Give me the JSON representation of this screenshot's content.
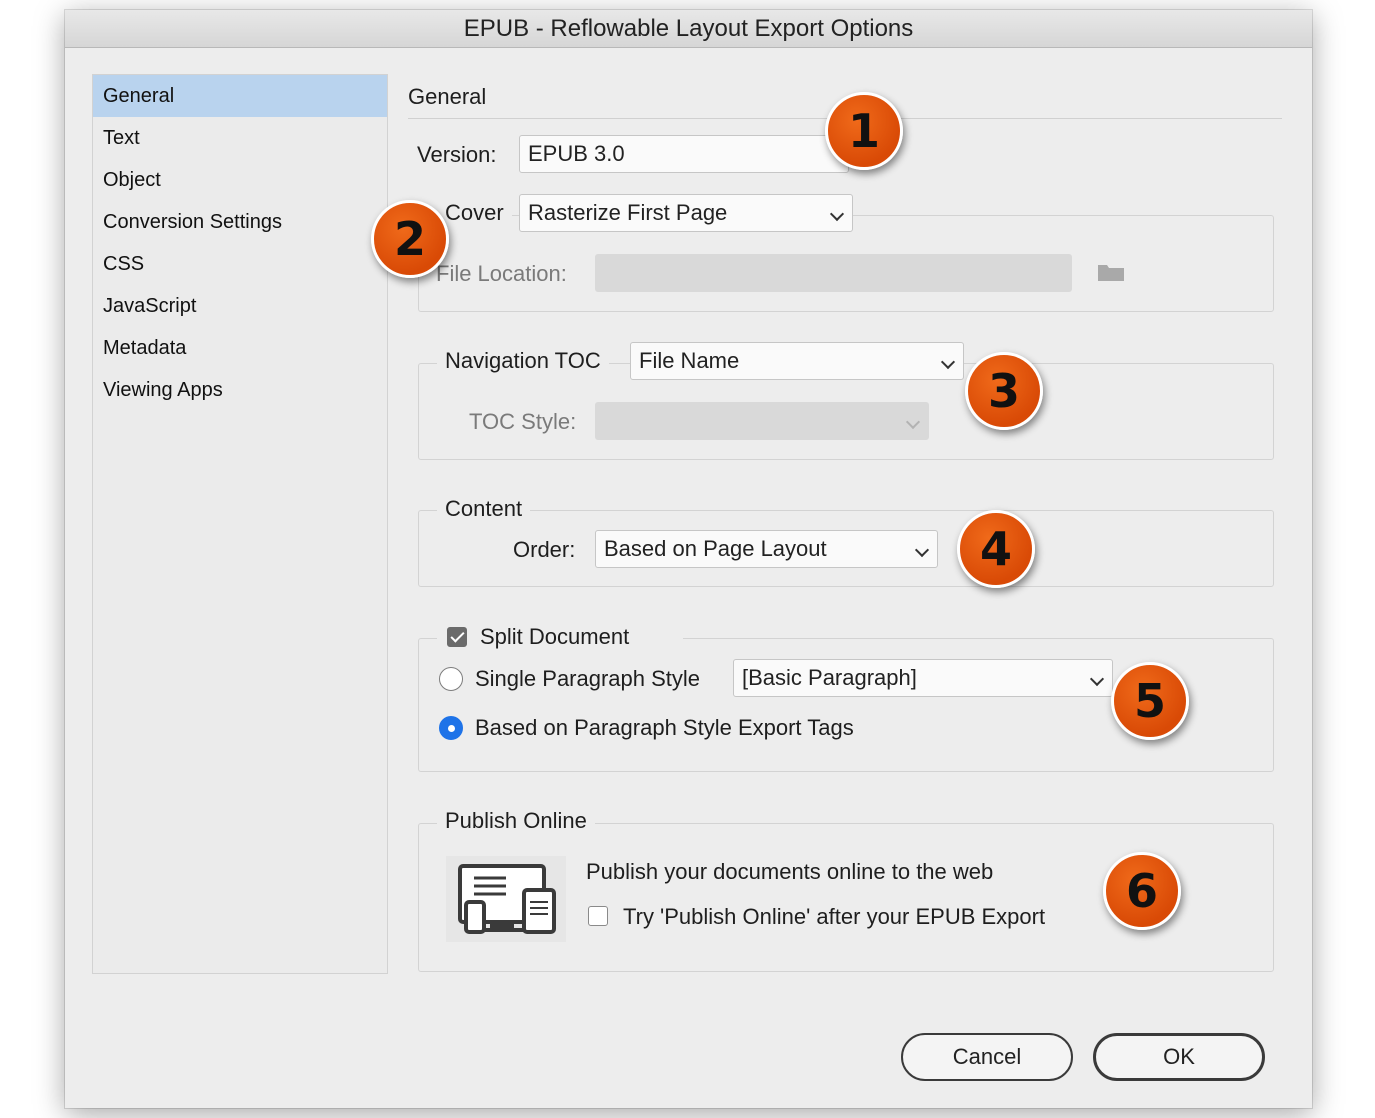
{
  "window": {
    "title": "EPUB - Reflowable Layout Export Options"
  },
  "sidebar": {
    "items": [
      {
        "label": "General",
        "selected": true
      },
      {
        "label": "Text"
      },
      {
        "label": "Object"
      },
      {
        "label": "Conversion Settings"
      },
      {
        "label": "CSS"
      },
      {
        "label": "JavaScript"
      },
      {
        "label": "Metadata"
      },
      {
        "label": "Viewing Apps"
      }
    ]
  },
  "general": {
    "heading": "General",
    "version": {
      "label": "Version:",
      "value": "EPUB 3.0"
    },
    "cover": {
      "label": "Cover",
      "value": "Rasterize First Page"
    },
    "file_location": {
      "label": "File Location:",
      "value": ""
    },
    "navigation": {
      "label": "Navigation TOC",
      "value": "File Name"
    },
    "toc_style": {
      "label": "TOC Style:",
      "value": ""
    },
    "content": {
      "legend": "Content",
      "order_label": "Order:",
      "order_value": "Based on Page Layout"
    },
    "split": {
      "label": "Split Document",
      "checked": true,
      "single_label": "Single Paragraph Style",
      "single_value": "[Basic Paragraph]",
      "tags_label": "Based on Paragraph Style Export Tags",
      "selected": "tags"
    },
    "publish": {
      "legend": "Publish Online",
      "description": "Publish your documents online to the web",
      "try_label": "Try 'Publish Online' after your EPUB Export",
      "try_checked": false
    }
  },
  "callouts": [
    "1",
    "2",
    "3",
    "4",
    "5",
    "6"
  ],
  "buttons": {
    "cancel": "Cancel",
    "ok": "OK"
  },
  "colors": {
    "callout": "#e2560f",
    "selection": "#b9d3ee",
    "radio_active": "#1e73e8"
  },
  "icons": {
    "folder": "folder-icon",
    "publish": "devices-icon",
    "dropdown": "chevron-down-icon"
  }
}
